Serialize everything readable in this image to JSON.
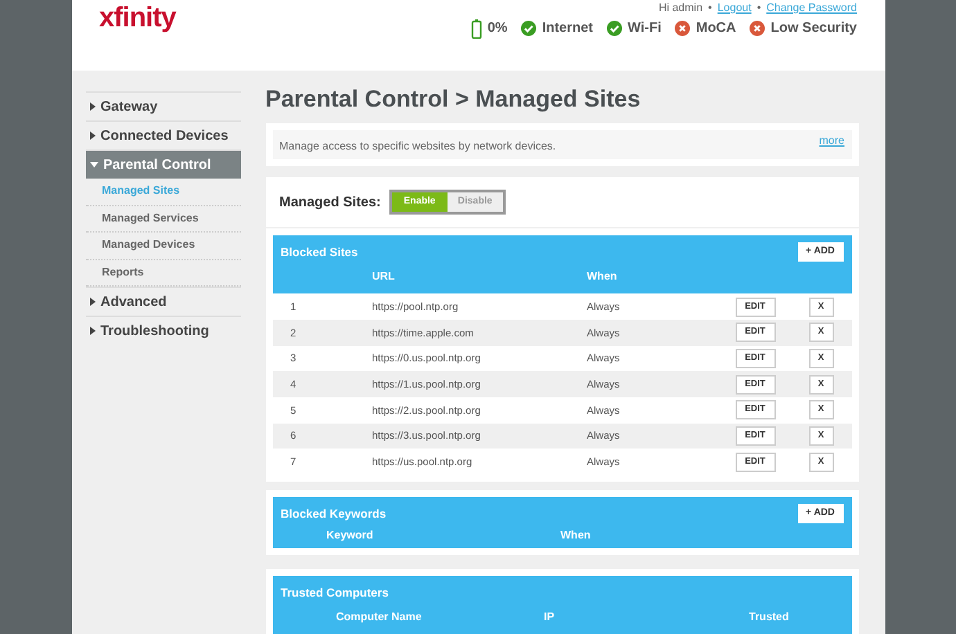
{
  "header": {
    "logo": "xfinity",
    "user_links": [
      {
        "kind": "text",
        "label": "Hi admin"
      },
      {
        "kind": "separator",
        "label": "•"
      },
      {
        "kind": "link",
        "label": "Logout"
      },
      {
        "kind": "separator",
        "label": "•"
      },
      {
        "kind": "link",
        "label": "Change Password"
      }
    ],
    "status": [
      {
        "kind": "battery",
        "label": "0%",
        "ok": true
      },
      {
        "kind": "check",
        "label": "Internet",
        "ok": true
      },
      {
        "kind": "check",
        "label": "Wi-Fi",
        "ok": true
      },
      {
        "kind": "check",
        "label": "MoCA",
        "ok": false
      },
      {
        "kind": "check",
        "label": "Low Security",
        "ok": false
      }
    ]
  },
  "sidebar": {
    "items": [
      {
        "label": "Gateway",
        "expanded": false,
        "selected": false
      },
      {
        "label": "Connected Devices",
        "expanded": false,
        "selected": false
      },
      {
        "label": "Parental Control",
        "expanded": true,
        "selected": true,
        "children": [
          {
            "label": "Managed Sites",
            "selected": true
          },
          {
            "label": "Managed Services",
            "selected": false
          },
          {
            "label": "Managed Devices",
            "selected": false
          },
          {
            "label": "Reports",
            "selected": false
          }
        ]
      },
      {
        "label": "Advanced",
        "expanded": false,
        "selected": false
      },
      {
        "label": "Troubleshooting",
        "expanded": false,
        "selected": false
      }
    ]
  },
  "page_title": "Parental Control > Managed Sites",
  "description": {
    "text": "Manage access to specific websites by network devices.",
    "link": "more"
  },
  "managed_sites": {
    "label": "Managed Sites:",
    "options": [
      {
        "label": "Enable",
        "selected": true
      },
      {
        "label": "Disable",
        "selected": false
      }
    ]
  },
  "blocked_sites": {
    "title": "Blocked Sites",
    "add": "+ ADD",
    "columns": [
      "URL",
      "When"
    ],
    "rows": [
      {
        "num": "1",
        "url": "https://pool.ntp.org",
        "when": "Always",
        "edit": "EDIT",
        "delete": "X"
      },
      {
        "num": "2",
        "url": "https://time.apple.com",
        "when": "Always",
        "edit": "EDIT",
        "delete": "X"
      },
      {
        "num": "3",
        "url": "https://0.us.pool.ntp.org",
        "when": "Always",
        "edit": "EDIT",
        "delete": "X"
      },
      {
        "num": "4",
        "url": "https://1.us.pool.ntp.org",
        "when": "Always",
        "edit": "EDIT",
        "delete": "X"
      },
      {
        "num": "5",
        "url": "https://2.us.pool.ntp.org",
        "when": "Always",
        "edit": "EDIT",
        "delete": "X"
      },
      {
        "num": "6",
        "url": "https://3.us.pool.ntp.org",
        "when": "Always",
        "edit": "EDIT",
        "delete": "X"
      },
      {
        "num": "7",
        "url": "https://us.pool.ntp.org",
        "when": "Always",
        "edit": "EDIT",
        "delete": "X"
      }
    ]
  },
  "blocked_keywords": {
    "title": "Blocked Keywords",
    "add": "+ ADD",
    "columns": [
      "Keyword",
      "When"
    ]
  },
  "trusted_computers": {
    "title": "Trusted Computers",
    "columns": [
      "Computer Name",
      "IP",
      "Trusted"
    ]
  }
}
